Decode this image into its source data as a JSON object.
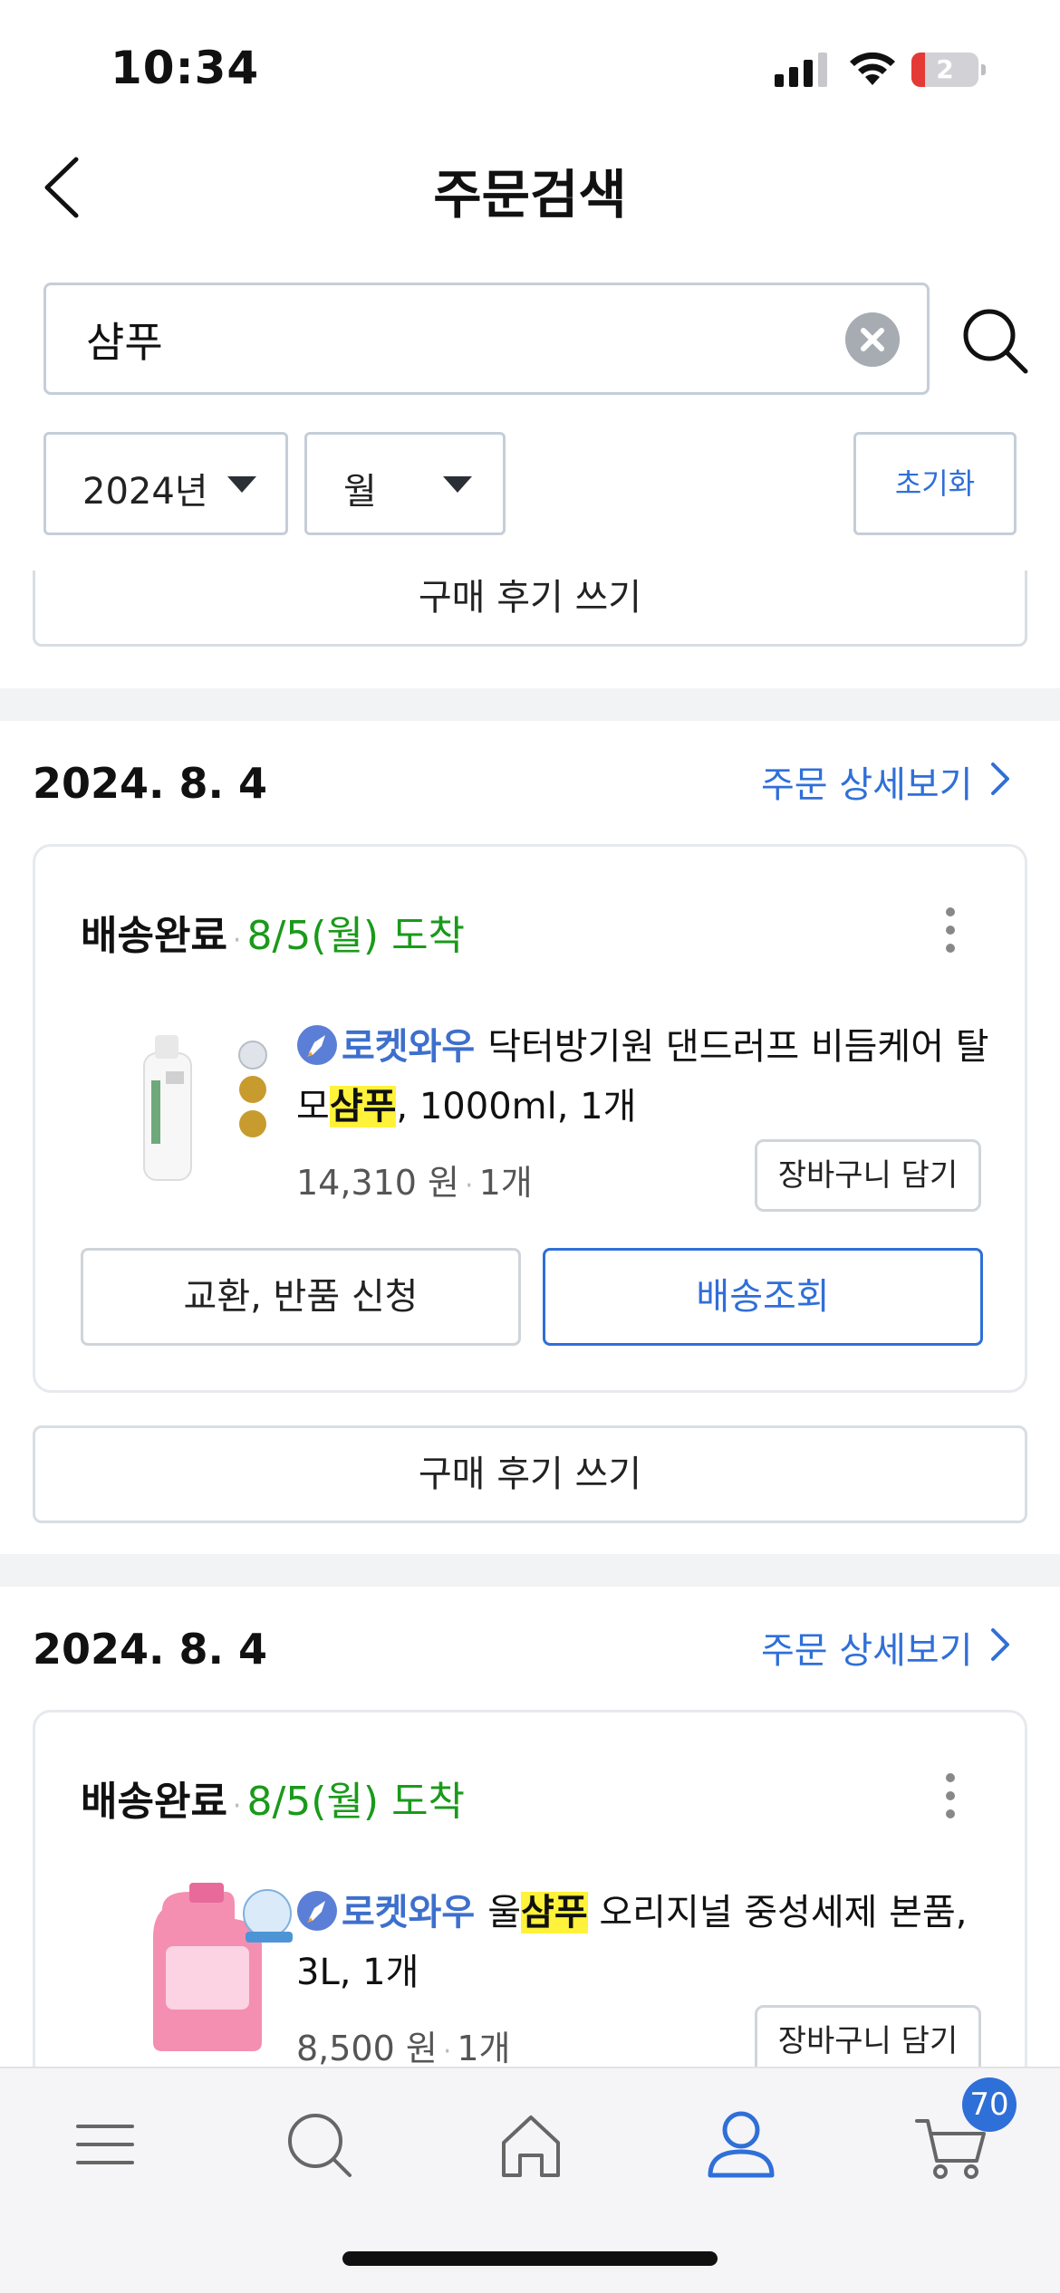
{
  "status_bar": {
    "time": "10:34",
    "battery_level": "2",
    "battery_fraction": 0.2,
    "icons": [
      "cellular-signal-icon",
      "wifi-icon",
      "battery-icon"
    ]
  },
  "header": {
    "title": "주문검색",
    "back_icon": "chevron-left-icon"
  },
  "search": {
    "value": "샴푸",
    "clear_icon": "clear-circle-icon",
    "search_icon": "search-icon"
  },
  "filters": {
    "year": "2024년",
    "month": "월",
    "reset_label": "초기화"
  },
  "partial_top": {
    "review_label": "구매 후기 쓰기"
  },
  "orders": [
    {
      "date": "2024. 8. 4",
      "detail_label": "주문 상세보기",
      "status": "배송완료",
      "arrival": "8/5(월) 도착",
      "rocket_label": "로켓와우",
      "title_pre": "닥터방기원 댄드러프 비듬케어 탈모",
      "title_highlight": "샴푸",
      "title_post": ", 1000ml, 1개",
      "price": "14,310 원",
      "qty": "1개",
      "cart_label": "장바구니 담기",
      "exchange_label": "교환, 반품 신청",
      "track_label": "배송조회",
      "review_label": "구매 후기 쓰기",
      "thumb_color": "#ffffff"
    },
    {
      "date": "2024. 8. 4",
      "detail_label": "주문 상세보기",
      "status": "배송완료",
      "arrival": "8/5(월) 도착",
      "rocket_label": "로켓와우",
      "title_pre": "울",
      "title_highlight": "샴푸",
      "title_post": " 오리지널 중성세제 본품, 3L, 1개",
      "price": "8,500 원",
      "qty": "1개",
      "cart_label": "장바구니 담기",
      "thumb_color": "#f48fb1"
    }
  ],
  "bottom_nav": {
    "items": [
      "menu-icon",
      "search-icon",
      "home-icon",
      "my-account-icon",
      "cart-icon"
    ],
    "active": "my-account-icon",
    "cart_count": "70"
  },
  "colors": {
    "accent": "#2f6fd8",
    "arrival_green": "#1a9a1a",
    "highlight": "#fff23a",
    "rocket_blue": "#3d6fcd"
  }
}
